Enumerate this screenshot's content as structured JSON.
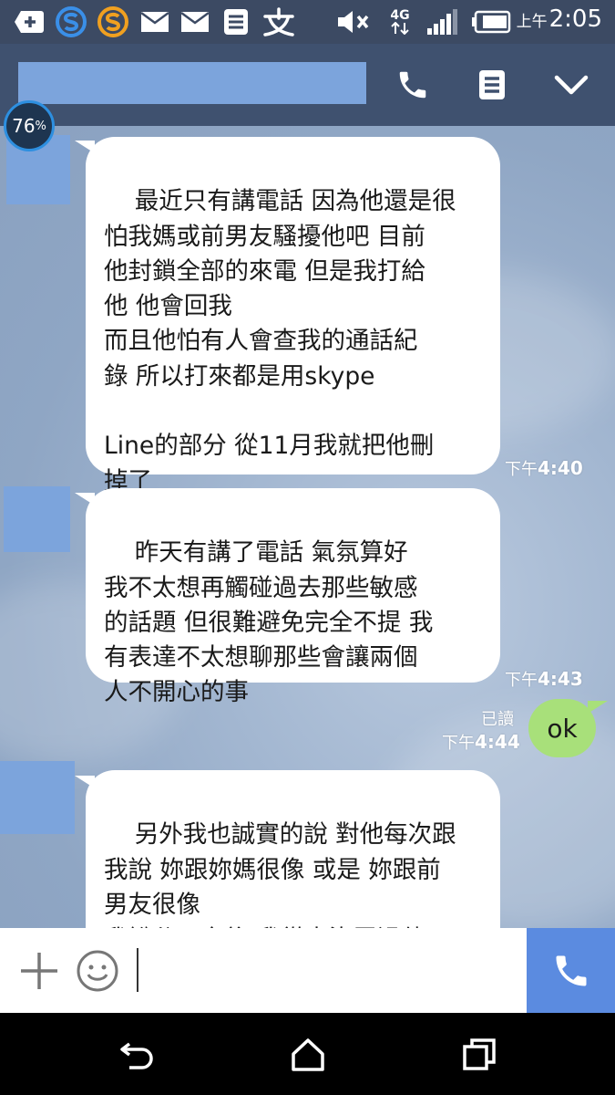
{
  "status_bar": {
    "time_prefix": "上午",
    "time": "2:05",
    "network": "4G",
    "icons": [
      "add-icon",
      "s-app-icon",
      "s-app-icon",
      "mail-icon",
      "mail-icon",
      "notes-icon",
      "friend-icon",
      "mute-icon",
      "signal-icon",
      "battery-icon"
    ]
  },
  "header": {
    "contact_name": "",
    "icons": [
      "phone-icon",
      "menu-icon",
      "chevron-down-icon"
    ]
  },
  "battery_badge": {
    "value": "76",
    "unit": "%"
  },
  "messages": [
    {
      "side": "left",
      "text": "最近只有講電話 因為他還是很\n怕我媽或前男友騷擾他吧 目前\n他封鎖全部的來電 但是我打給\n他 他會回我\n而且他怕有人會查我的通話紀\n錄 所以打來都是用skype\n\nLine的部分 從11月我就把他刪\n掉了",
      "time_prefix": "下午",
      "time": "4:40"
    },
    {
      "side": "left",
      "text": "昨天有講了電話 氣氛算好\n我不太想再觸碰過去那些敏感\n的話題 但很難避免完全不提 我\n有表達不太想聊那些會讓兩個\n人不開心的事",
      "time_prefix": "下午",
      "time": "4:43"
    },
    {
      "side": "right",
      "text": "ok",
      "read": "已讀",
      "time_prefix": "下午",
      "time": "4:44"
    },
    {
      "side": "left",
      "text": "另外我也誠實的說 對他每次跟\n我說 妳跟妳媽很像 或是 妳跟前\n男友很像\n我說分了之後 我從來沒罵過他"
    }
  ],
  "input": {
    "placeholder": "",
    "icons": [
      "plus-icon",
      "emoji-icon",
      "phone-icon"
    ]
  },
  "nav": {
    "icons": [
      "back-icon",
      "home-icon",
      "recents-icon"
    ]
  },
  "colors": {
    "header": "#3f516f",
    "status": "#3c4a63",
    "accent": "#5b8be0",
    "sent_bubble": "#a8e07a",
    "redaction": "#7ca4dc"
  }
}
